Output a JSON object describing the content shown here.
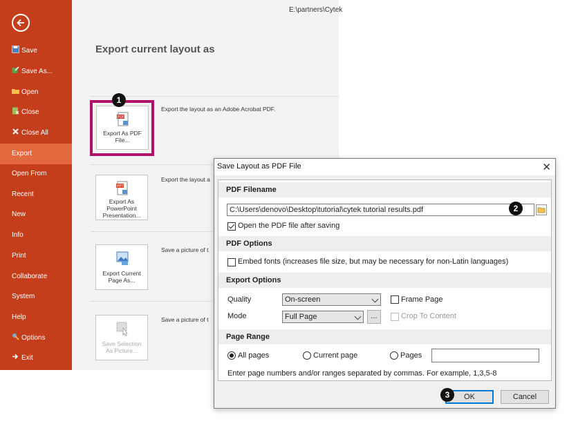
{
  "sidebar": {
    "items": [
      {
        "label": "Save",
        "icon": "save-icon"
      },
      {
        "label": "Save As...",
        "icon": "save-as-icon"
      },
      {
        "label": "Open",
        "icon": "folder-open-icon"
      },
      {
        "label": "Close",
        "icon": "close-doc-icon"
      },
      {
        "label": "Close All",
        "icon": "close-all-icon"
      },
      {
        "label": "Export"
      },
      {
        "label": "Open From"
      },
      {
        "label": "Recent"
      },
      {
        "label": "New"
      },
      {
        "label": "Info"
      },
      {
        "label": "Print"
      },
      {
        "label": "Collaborate"
      },
      {
        "label": "System"
      },
      {
        "label": "Help"
      },
      {
        "label": "Options",
        "icon": "options-icon"
      },
      {
        "label": "Exit",
        "icon": "exit-icon"
      }
    ],
    "active": "Export"
  },
  "main": {
    "path": "E:\\partners\\Cytek",
    "title": "Export current layout as",
    "tiles": [
      {
        "label": "Export As PDF File...",
        "desc": "Export the layout as an Adobe Acrobat PDF."
      },
      {
        "label": "Export As PowerPoint Presentation...",
        "desc": "Export the layout a"
      },
      {
        "label": "Export Current Page As...",
        "desc": "Save a picture of t"
      },
      {
        "label": "Save Selection As Picture...",
        "desc": "Save a picture of t"
      }
    ]
  },
  "callouts": [
    "1",
    "2",
    "3"
  ],
  "dialog": {
    "title": "Save Layout as PDF File",
    "sections": {
      "filename": "PDF Filename",
      "options": "PDF Options",
      "export": "Export Options",
      "range": "Page Range"
    },
    "filename_value": "C:\\Users\\denovo\\Desktop\\tutorial\\cytek tutorial results.pdf",
    "open_after_label": "Open the PDF file after saving",
    "embed_fonts_label": "Embed fonts (increases file size, but may be necessary for non-Latin languages)",
    "quality_label": "Quality",
    "quality_value": "On-screen",
    "frame_page_label": "Frame Page",
    "mode_label": "Mode",
    "mode_value": "Full Page",
    "ellipsis_label": "...",
    "crop_label": "Crop To Content",
    "all_pages_label": "All pages",
    "current_page_label": "Current page",
    "pages_label": "Pages",
    "pages_value": "",
    "hint": "Enter page numbers and/or ranges separated by commas. For example, 1,3,5-8",
    "ok_label": "OK",
    "cancel_label": "Cancel"
  },
  "colors": {
    "sidebar": "#c43e1c",
    "active_nav": "#e3683e",
    "highlight": "#b3106b"
  }
}
